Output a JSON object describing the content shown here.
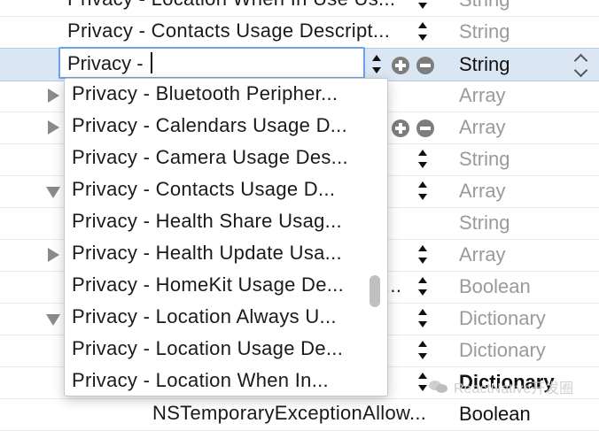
{
  "rows": [
    {
      "key": "Privacy - Location When In Use Us...",
      "type": "String"
    },
    {
      "key": "Privacy - Contacts Usage Descript...",
      "type": "String"
    },
    {
      "key": "",
      "type": "String"
    },
    {
      "key": "",
      "type": "Array"
    },
    {
      "key": "",
      "type": "Array"
    },
    {
      "key": "",
      "type": "String"
    },
    {
      "key": "",
      "type": "Array"
    },
    {
      "key": "",
      "type": "String"
    },
    {
      "key": "",
      "type": "Array"
    },
    {
      "key": "...",
      "type": "Boolean"
    },
    {
      "key": "",
      "type": "Dictionary"
    },
    {
      "key": "",
      "type": "Dictionary"
    },
    {
      "key": "",
      "type": "Dictionary"
    },
    {
      "key": "NSTemporaryExceptionAllow...",
      "type": "Boolean"
    }
  ],
  "editor": {
    "value": "Privacy - "
  },
  "suggestions": [
    "Privacy - Bluetooth Peripher...",
    "Privacy - Calendars Usage D...",
    "Privacy - Camera Usage Des...",
    "Privacy - Contacts Usage D...",
    "Privacy - Health Share Usag...",
    "Privacy - Health Update Usa...",
    "Privacy - HomeKit Usage De...",
    "Privacy - Location Always U...",
    "Privacy - Location Usage De...",
    "Privacy - Location When In..."
  ],
  "watermark": {
    "text": "ReactNative开发圈"
  },
  "icons": {
    "disclosure_collapsed": "triangle-right-icon",
    "disclosure_expanded": "triangle-down-icon",
    "add": "plus-circle-icon",
    "remove": "minus-circle-icon",
    "stepper": "up-down-arrows-icon"
  },
  "colors": {
    "selection": "#dbe6f5",
    "focus_ring": "#6aa3e8",
    "type_text": "#9a9a9a"
  }
}
